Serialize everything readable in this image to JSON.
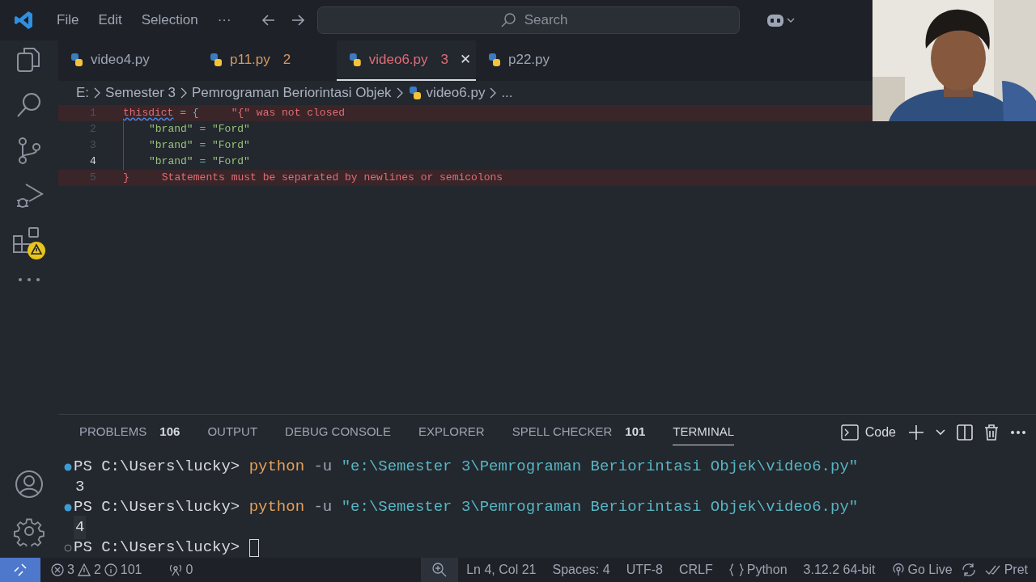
{
  "title_bar": {
    "menu": [
      "File",
      "Edit",
      "Selection",
      "···"
    ],
    "search": {
      "placeholder": "Search"
    }
  },
  "tabs": [
    {
      "label": "video4.py",
      "color": "#9da5b4",
      "selected": false
    },
    {
      "label": "p11.py",
      "count": "2",
      "color": "#d19a66",
      "selected": false
    },
    {
      "label": "video6.py",
      "count": "3",
      "color": "#e06c75",
      "selected": true,
      "close": "✕"
    },
    {
      "label": "p22.py",
      "color": "#9da5b4",
      "selected": false
    }
  ],
  "breadcrumb": [
    {
      "text": "E:",
      "kind": "folder"
    },
    {
      "text": "Semester 3",
      "kind": "folder"
    },
    {
      "text": "Pemrograman Beriorintasi Objek",
      "kind": "folder"
    },
    {
      "text": "video6.py",
      "kind": "file"
    },
    {
      "text": "...",
      "kind": "more"
    }
  ],
  "editor": {
    "lines": [
      {
        "number": "1",
        "error": true,
        "current": false,
        "indented": false,
        "tokens": [
          {
            "text": "thisdict",
            "kind": "variable-error"
          },
          {
            "text": " = ",
            "kind": "operator"
          },
          {
            "text": "{",
            "kind": "bracket"
          }
        ],
        "message": "\"{\" was not closed"
      },
      {
        "number": "2",
        "error": false,
        "current": false,
        "indented": true,
        "tokens": [
          {
            "text": "\"brand\"",
            "kind": "string"
          },
          {
            "text": " = ",
            "kind": "operator"
          },
          {
            "text": "\"Ford\"",
            "kind": "string"
          }
        ]
      },
      {
        "number": "3",
        "error": false,
        "current": false,
        "indented": true,
        "tokens": [
          {
            "text": "\"brand\"",
            "kind": "string"
          },
          {
            "text": " = ",
            "kind": "operator"
          },
          {
            "text": "\"Ford\"",
            "kind": "string"
          }
        ]
      },
      {
        "number": "4",
        "error": false,
        "current": true,
        "indented": true,
        "tokens": [
          {
            "text": "\"brand\"",
            "kind": "string"
          },
          {
            "text": " = ",
            "kind": "operator"
          },
          {
            "text": "\"Ford\"",
            "kind": "string"
          }
        ]
      },
      {
        "number": "5",
        "error": true,
        "current": false,
        "indented": false,
        "tokens": [
          {
            "text": "}",
            "kind": "bracket-error"
          }
        ],
        "message": "Statements must be separated by newlines or semicolons"
      }
    ]
  },
  "panel": {
    "tabs": [
      {
        "label": "PROBLEMS",
        "count": "106",
        "selected": false
      },
      {
        "label": "OUTPUT",
        "selected": false
      },
      {
        "label": "DEBUG CONSOLE",
        "selected": false
      },
      {
        "label": "EXPLORER",
        "selected": false
      },
      {
        "label": "SPELL CHECKER",
        "count": "101",
        "selected": false
      },
      {
        "label": "TERMINAL",
        "selected": true
      }
    ],
    "terminal_name": "Code",
    "terminal": [
      {
        "kind": "prompt",
        "succeeded": true,
        "prompt": "PS C:\\Users\\lucky>",
        "command": "python",
        "args": "-u",
        "path": "\"e:\\Semester 3\\Pemrograman Beriorintasi Objek\\video6.py\""
      },
      {
        "kind": "output",
        "text": "3",
        "highlighted": false
      },
      {
        "kind": "prompt",
        "succeeded": true,
        "prompt": "PS C:\\Users\\lucky>",
        "command": "python",
        "args": "-u",
        "path": "\"e:\\Semester 3\\Pemrograman Beriorintasi Objek\\video6.py\""
      },
      {
        "kind": "output",
        "text": "4",
        "highlighted": true
      },
      {
        "kind": "prompt",
        "succeeded": false,
        "prompt": "PS C:\\Users\\lucky>",
        "cursor": true
      }
    ]
  },
  "status_bar": {
    "errors": "3",
    "warnings": "2",
    "infos": "101",
    "ports": "0",
    "right": [
      {
        "text": "Ln 4, Col 21",
        "kind": "text"
      },
      {
        "text": "Spaces: 4",
        "kind": "text"
      },
      {
        "text": "UTF-8",
        "kind": "text"
      },
      {
        "text": "CRLF",
        "kind": "text"
      },
      {
        "text": "Python",
        "kind": "language"
      },
      {
        "text": "3.12.2 64-bit",
        "kind": "text"
      },
      {
        "text": "Go Live",
        "kind": "live"
      },
      {
        "text": "Pret",
        "kind": "prettier"
      }
    ]
  }
}
